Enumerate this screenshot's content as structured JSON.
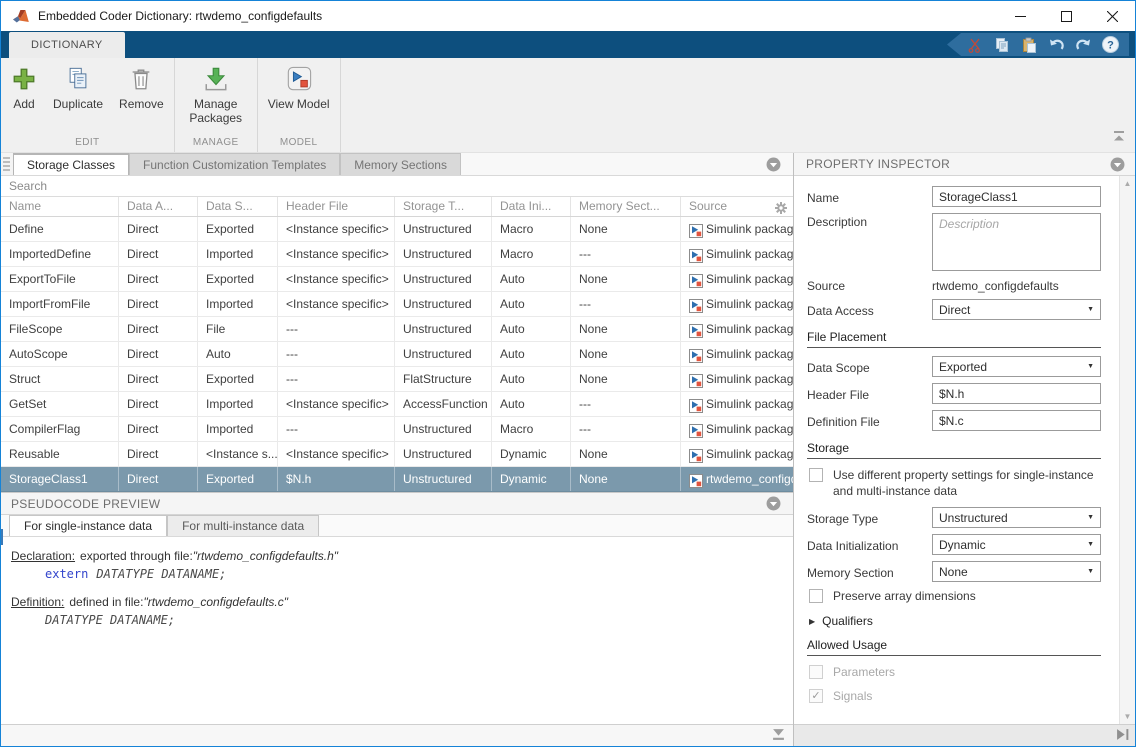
{
  "titlebar": {
    "title": "Embedded Coder Dictionary: rtwdemo_configdefaults"
  },
  "ribbon": {
    "tab_label": "DICTIONARY",
    "buttons": [
      {
        "label": "Add",
        "icon": "add-icon"
      },
      {
        "label": "Duplicate",
        "icon": "duplicate-icon"
      },
      {
        "label": "Remove",
        "icon": "remove-icon"
      },
      {
        "label": "Manage Packages",
        "icon": "manage-packages-icon"
      },
      {
        "label": "View Model",
        "icon": "view-model-icon"
      }
    ],
    "group_labels": [
      "EDIT",
      "MANAGE",
      "MODEL"
    ],
    "quick_access_icons": [
      "cut-icon",
      "copy-icon",
      "paste-icon",
      "undo-icon",
      "redo-icon",
      "help-icon"
    ]
  },
  "doc_tabs": [
    {
      "label": "Storage Classes",
      "active": true
    },
    {
      "label": "Function Customization Templates",
      "active": false
    },
    {
      "label": "Memory Sections",
      "active": false
    }
  ],
  "search": {
    "placeholder": "Search"
  },
  "table": {
    "columns": [
      "Name",
      "Data A...",
      "Data S...",
      "Header File",
      "Storage T...",
      "Data Ini...",
      "Memory Sect...",
      "Source"
    ],
    "rows": [
      {
        "name": "Define",
        "data_access": "Direct",
        "data_scope": "Exported",
        "header_file": "<Instance specific>",
        "storage_type": "Unstructured",
        "data_init": "Macro",
        "memory_section": "None",
        "source": "Simulink package",
        "selected": false
      },
      {
        "name": "ImportedDefine",
        "data_access": "Direct",
        "data_scope": "Imported",
        "header_file": "<Instance specific>",
        "storage_type": "Unstructured",
        "data_init": "Macro",
        "memory_section": "---",
        "source": "Simulink package",
        "selected": false
      },
      {
        "name": "ExportToFile",
        "data_access": "Direct",
        "data_scope": "Exported",
        "header_file": "<Instance specific>",
        "storage_type": "Unstructured",
        "data_init": "Auto",
        "memory_section": "None",
        "source": "Simulink package",
        "selected": false
      },
      {
        "name": "ImportFromFile",
        "data_access": "Direct",
        "data_scope": "Imported",
        "header_file": "<Instance specific>",
        "storage_type": "Unstructured",
        "data_init": "Auto",
        "memory_section": "---",
        "source": "Simulink package",
        "selected": false
      },
      {
        "name": "FileScope",
        "data_access": "Direct",
        "data_scope": "File",
        "header_file": "---",
        "storage_type": "Unstructured",
        "data_init": "Auto",
        "memory_section": "None",
        "source": "Simulink package",
        "selected": false
      },
      {
        "name": "AutoScope",
        "data_access": "Direct",
        "data_scope": "Auto",
        "header_file": "---",
        "storage_type": "Unstructured",
        "data_init": "Auto",
        "memory_section": "None",
        "source": "Simulink package",
        "selected": false
      },
      {
        "name": "Struct",
        "data_access": "Direct",
        "data_scope": "Exported",
        "header_file": "---",
        "storage_type": "FlatStructure",
        "data_init": "Auto",
        "memory_section": "None",
        "source": "Simulink package",
        "selected": false
      },
      {
        "name": "GetSet",
        "data_access": "Direct",
        "data_scope": "Imported",
        "header_file": "<Instance specific>",
        "storage_type": "AccessFunction",
        "data_init": "Auto",
        "memory_section": "---",
        "source": "Simulink package",
        "selected": false
      },
      {
        "name": "CompilerFlag",
        "data_access": "Direct",
        "data_scope": "Imported",
        "header_file": "---",
        "storage_type": "Unstructured",
        "data_init": "Macro",
        "memory_section": "---",
        "source": "Simulink package",
        "selected": false
      },
      {
        "name": "Reusable",
        "data_access": "Direct",
        "data_scope": "<Instance s...",
        "header_file": "<Instance specific>",
        "storage_type": "Unstructured",
        "data_init": "Dynamic",
        "memory_section": "None",
        "source": "Simulink package",
        "selected": false
      },
      {
        "name": "StorageClass1",
        "data_access": "Direct",
        "data_scope": "Exported",
        "header_file": "$N.h",
        "storage_type": "Unstructured",
        "data_init": "Dynamic",
        "memory_section": "None",
        "source": "rtwdemo_configdefaults",
        "selected": true
      }
    ]
  },
  "pseudocode": {
    "title": "PSEUDOCODE PREVIEW",
    "tabs": [
      {
        "label": "For single-instance data",
        "active": true
      },
      {
        "label": "For multi-instance data",
        "active": false
      }
    ],
    "declaration_label": "Declaration:",
    "declaration_text": "exported through file:",
    "declaration_file": "\"rtwdemo_configdefaults.h\"",
    "declaration_keyword": "extern",
    "declaration_code": "DATATYPE DATANAME;",
    "definition_label": "Definition:",
    "definition_text": "defined in file:",
    "definition_file": "\"rtwdemo_configdefaults.c\"",
    "definition_code": "DATATYPE DATANAME;"
  },
  "inspector": {
    "title": "PROPERTY INSPECTOR",
    "name_label": "Name",
    "name_value": "StorageClass1",
    "description_label": "Description",
    "description_placeholder": "Description",
    "source_label": "Source",
    "source_value": "rtwdemo_configdefaults",
    "data_access_label": "Data Access",
    "data_access_value": "Direct",
    "file_placement_section": "File Placement",
    "data_scope_label": "Data Scope",
    "data_scope_value": "Exported",
    "header_file_label": "Header File",
    "header_file_value": "$N.h",
    "definition_file_label": "Definition File",
    "definition_file_value": "$N.c",
    "storage_section": "Storage",
    "single_multi_checkbox": "Use different property settings for single-instance and multi-instance data",
    "storage_type_label": "Storage Type",
    "storage_type_value": "Unstructured",
    "data_init_label": "Data Initialization",
    "data_init_value": "Dynamic",
    "memory_section_label": "Memory Section",
    "memory_section_value": "None",
    "preserve_checkbox": "Preserve array dimensions",
    "qualifiers_label": "Qualifiers",
    "allowed_usage_section": "Allowed Usage",
    "parameters_checkbox": "Parameters",
    "signals_checkbox": "Signals",
    "signals_checked": "✓"
  },
  "colors": {
    "ribbon": "#0d4f7e",
    "selection": "#7b99ac",
    "window_border": "#1583d7",
    "keyword_blue": "#3345cc"
  }
}
